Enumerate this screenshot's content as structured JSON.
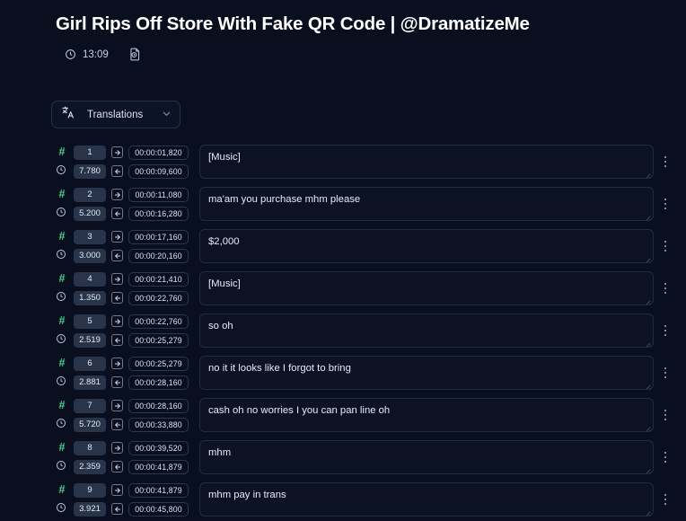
{
  "header": {
    "title": "Girl Rips Off Store With Fake QR Code | @DramatizeMe",
    "duration": "13:09",
    "clock_icon": "clock-icon",
    "document_history_icon": "document-clock-icon"
  },
  "toolbar": {
    "translations_label": "Translations",
    "translate_icon": "translate-icon",
    "chevron_icon": "chevron-down-icon"
  },
  "colors": {
    "background": "#0a0f1f",
    "accent_green": "#4ed18a",
    "pill_background": "#27344a",
    "field_background": "#0c1223",
    "border": "#273145",
    "text": "#e8edf5"
  },
  "icons": {
    "hash": "#",
    "row_clock": "clock-icon",
    "start_marker": "arrow-right-box-icon",
    "end_marker": "arrow-left-box-icon",
    "row_menu": "kebab-menu-icon",
    "resize": "resize-handle-icon"
  },
  "subtitles": [
    {
      "index": "1",
      "duration": "7.780",
      "start": "00:00:01,820",
      "end": "00:00:09,600",
      "text": "[Music]"
    },
    {
      "index": "2",
      "duration": "5.200",
      "start": "00:00:11,080",
      "end": "00:00:16,280",
      "text": "ma'am you purchase mhm please"
    },
    {
      "index": "3",
      "duration": "3.000",
      "start": "00:00:17,160",
      "end": "00:00:20,160",
      "text": "$2,000"
    },
    {
      "index": "4",
      "duration": "1.350",
      "start": "00:00:21,410",
      "end": "00:00:22,760",
      "text": "[Music]"
    },
    {
      "index": "5",
      "duration": "2.519",
      "start": "00:00:22,760",
      "end": "00:00:25,279",
      "text": "so oh"
    },
    {
      "index": "6",
      "duration": "2.881",
      "start": "00:00:25,279",
      "end": "00:00:28,160",
      "text": "no it it looks like I forgot to bring"
    },
    {
      "index": "7",
      "duration": "5.720",
      "start": "00:00:28,160",
      "end": "00:00:33,880",
      "text": "cash oh no worries I you can pan line oh"
    },
    {
      "index": "8",
      "duration": "2.359",
      "start": "00:00:39,520",
      "end": "00:00:41,879",
      "text": "mhm"
    },
    {
      "index": "9",
      "duration": "3.921",
      "start": "00:00:41,879",
      "end": "00:00:45,800",
      "text": "mhm pay in trans"
    }
  ]
}
